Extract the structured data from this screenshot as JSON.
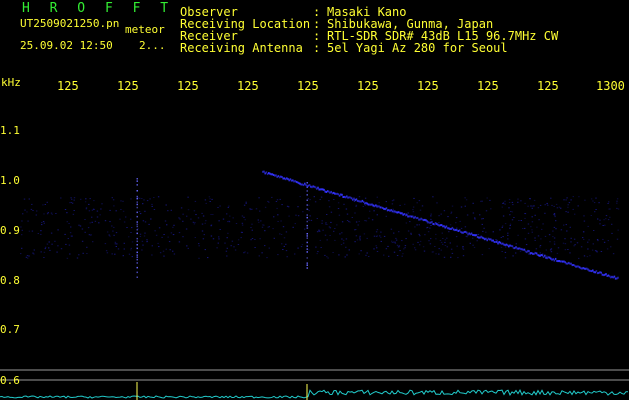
{
  "header": {
    "app_title": "H R O F F T",
    "file_name": "UT2509021250.pn",
    "label_meteor": "meteor",
    "datetime": "25.09.02 12:50",
    "meteor_count": "2..."
  },
  "station_info": {
    "rows": [
      {
        "label": "Observer",
        "sep": ":",
        "value": "Masaki Kano"
      },
      {
        "label": "Receiving Location",
        "sep": ":",
        "value": "Shibukawa, Gunma, Japan"
      },
      {
        "label": "Receiver",
        "sep": ":",
        "value": "RTL-SDR SDR# 43dB L15 96.7MHz CW"
      },
      {
        "label": "Receiving Antenna",
        "sep": ":",
        "value": "5el Yagi Az 280 for Seoul"
      }
    ]
  },
  "axes": {
    "y_unit": "kHz",
    "y_ticks": [
      "1.1",
      "1.0",
      "0.9",
      "0.8",
      "0.7",
      "0.6"
    ],
    "x_ticks": [
      "125",
      "125",
      "125",
      "125",
      "125",
      "125",
      "125",
      "125",
      "125",
      "1300"
    ]
  },
  "colors": {
    "background": "#000000",
    "text": "#ffff33",
    "title": "#33ee33",
    "signal": "#3333ff",
    "noise": "#1a1a90",
    "level_trace": "#22cccc",
    "guide": "#999999"
  }
}
